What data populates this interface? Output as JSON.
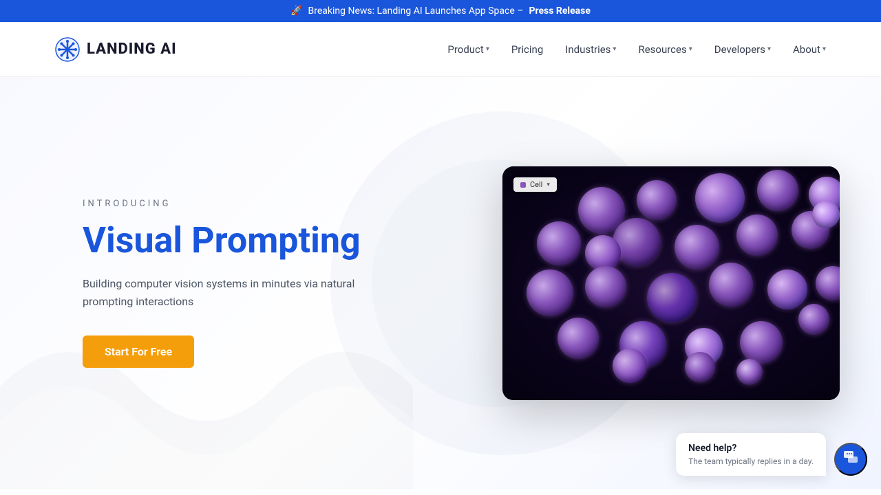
{
  "announcement": {
    "emoji": "🚀",
    "text": "Breaking News: Landing AI Launches App Space –",
    "link_text": "Press Release"
  },
  "header": {
    "logo_text": "LANDING AI",
    "nav_items": [
      {
        "label": "Product",
        "has_dropdown": true
      },
      {
        "label": "Pricing",
        "has_dropdown": false
      },
      {
        "label": "Industries",
        "has_dropdown": true
      },
      {
        "label": "Resources",
        "has_dropdown": true
      },
      {
        "label": "Developers",
        "has_dropdown": true
      },
      {
        "label": "About",
        "has_dropdown": true
      }
    ]
  },
  "hero": {
    "tag": "INTRODUCING",
    "title": "Visual Prompting",
    "description": "Building computer vision systems in minutes via natural prompting interactions",
    "cta_label": "Start For Free",
    "image_label": "Cell"
  },
  "chat": {
    "title": "Need help?",
    "subtitle": "The team typically replies in a day."
  },
  "colors": {
    "accent_blue": "#1a56db",
    "accent_orange": "#f59e0b",
    "accent_purple": "#8855bb",
    "text_dark": "#1a1a2e",
    "text_gray": "#4b5563"
  }
}
